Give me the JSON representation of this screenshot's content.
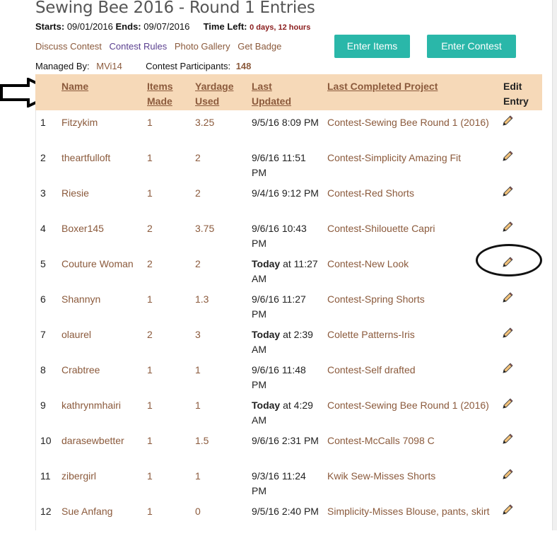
{
  "contest": {
    "title": "Sewing Bee 2016 - Round 1 Entries",
    "starts_label": "Starts:",
    "starts": "09/01/2016",
    "ends_label": "Ends:",
    "ends": "09/07/2016",
    "time_left_label": "Time Left:",
    "time_left": "0 days, 12 hours"
  },
  "nav": {
    "discuss": "Discuss Contest",
    "rules": "Contest Rules",
    "gallery": "Photo Gallery",
    "badge": "Get Badge",
    "enter_items": "Enter Items",
    "enter_contest": "Enter Contest"
  },
  "managed": {
    "label": "Managed By:",
    "user": "MVi14",
    "participants_label": "Contest Participants:",
    "participants": "148"
  },
  "table": {
    "headers": {
      "name": "Name",
      "items_1": "Items",
      "items_2": "Made",
      "yard_1": "Yardage",
      "yard_2": "Used",
      "upd_1": "Last",
      "upd_2": "Updated",
      "proj": "Last Completed Project",
      "edit_1": "Edit",
      "edit_2": "Entry"
    },
    "rows": [
      {
        "num": "1",
        "name": "Fitzykim",
        "items": "1",
        "yardage": "3.25",
        "upd_bold": "",
        "upd_rest": "9/5/16 8:09 PM",
        "project": "Contest-Sewing Bee Round 1 (2016)"
      },
      {
        "num": "2",
        "name": "theartfulloft",
        "items": "1",
        "yardage": "2",
        "upd_bold": "",
        "upd_rest": "9/6/16 11:51 PM",
        "project": "Contest-Simplicity Amazing Fit"
      },
      {
        "num": "3",
        "name": "Riesie",
        "items": "1",
        "yardage": "2",
        "upd_bold": "",
        "upd_rest": "9/4/16 9:12 PM",
        "project": "Contest-Red Shorts"
      },
      {
        "num": "4",
        "name": "Boxer145",
        "items": "2",
        "yardage": "3.75",
        "upd_bold": "",
        "upd_rest": "9/6/16 10:43 PM",
        "project": "Contest-Shilouette Capri"
      },
      {
        "num": "5",
        "name": "Couture Woman",
        "items": "2",
        "yardage": "2",
        "upd_bold": "Today",
        "upd_rest": " at 11:27 AM",
        "project": "Contest-New Look"
      },
      {
        "num": "6",
        "name": "Shannyn",
        "items": "1",
        "yardage": "1.3",
        "upd_bold": "",
        "upd_rest": "9/6/16 11:27 PM",
        "project": "Contest-Spring Shorts"
      },
      {
        "num": "7",
        "name": "olaurel",
        "items": "2",
        "yardage": "3",
        "upd_bold": "Today",
        "upd_rest": " at 2:39 AM",
        "project": "Colette Patterns-Iris"
      },
      {
        "num": "8",
        "name": "Crabtree",
        "items": "1",
        "yardage": "1",
        "upd_bold": "",
        "upd_rest": "9/6/16 11:48 PM",
        "project": "Contest-Self drafted"
      },
      {
        "num": "9",
        "name": "kathrynmhairi",
        "items": "1",
        "yardage": "1",
        "upd_bold": "Today",
        "upd_rest": " at 4:29 AM",
        "project": "Contest-Sewing Bee Round 1 (2016)"
      },
      {
        "num": "10",
        "name": "darasewbetter",
        "items": "1",
        "yardage": "1.5",
        "upd_bold": "",
        "upd_rest": "9/6/16 2:31 PM",
        "project": "Contest-McCalls 7098 C"
      },
      {
        "num": "11",
        "name": "zibergirl",
        "items": "1",
        "yardage": "1",
        "upd_bold": "",
        "upd_rest": "9/3/16 11:24 PM",
        "project": "Kwik Sew-Misses Shorts"
      },
      {
        "num": "12",
        "name": "Sue Anfang",
        "items": "1",
        "yardage": "0",
        "upd_bold": "",
        "upd_rest": "9/5/16 2:40 PM",
        "project": "Simplicity-Misses Blouse, pants, skirt"
      }
    ]
  },
  "colors": {
    "accent_button": "#2ab7a9",
    "header_bg": "#f6d9b8",
    "link": "#8b5a3c"
  }
}
